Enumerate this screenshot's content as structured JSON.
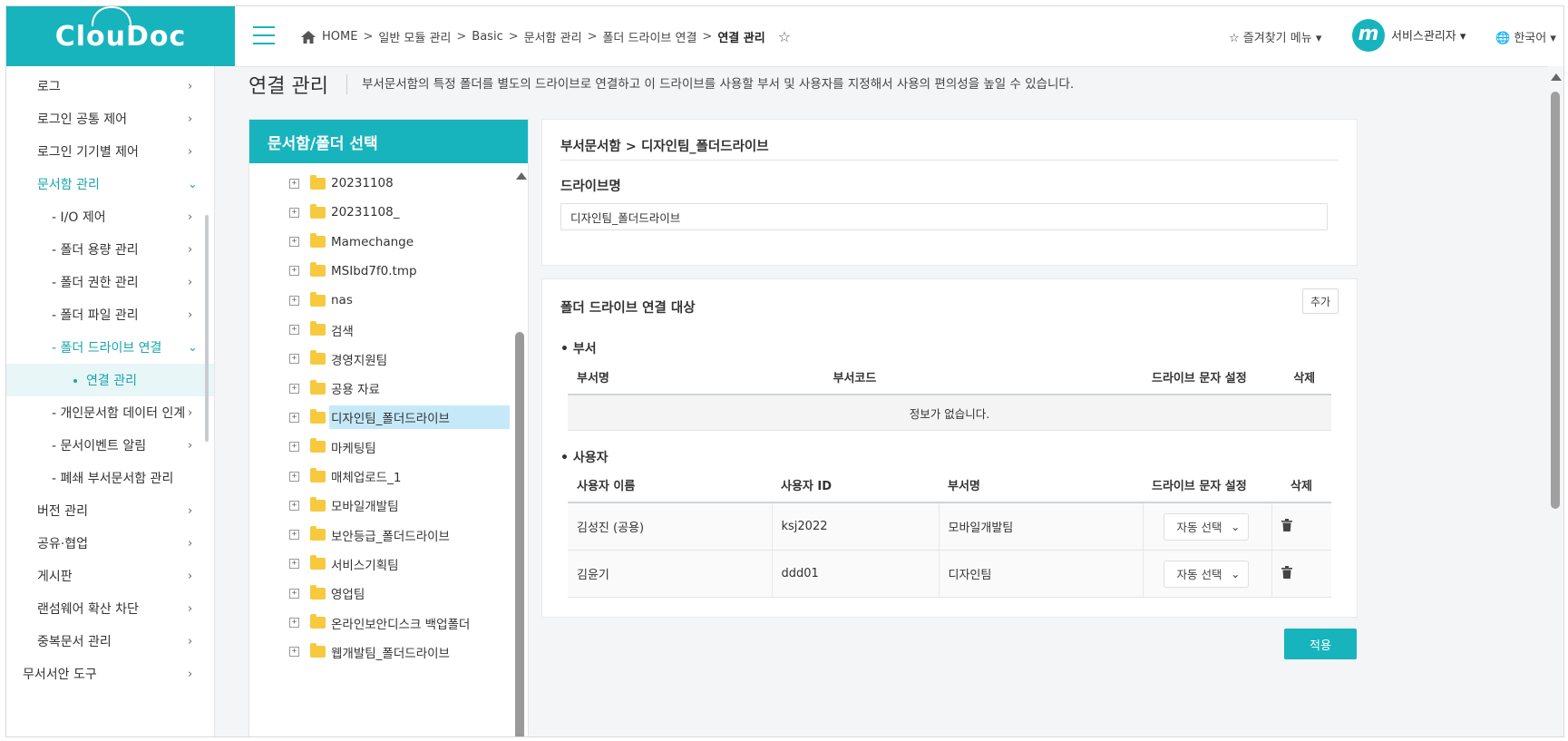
{
  "app": {
    "logo": "ClouDoc"
  },
  "topbar": {
    "breadcrumb": [
      "HOME",
      "일반 모듈 관리",
      "Basic",
      "문서함 관리",
      "폴더 드라이브 연결"
    ],
    "breadcrumb_current": "연결 관리",
    "favorites": "즐겨찾기 메뉴",
    "user_badge": "m",
    "user": "서비스관리자",
    "language": "한국어",
    "caret": "▾"
  },
  "sidebar": {
    "items": [
      {
        "label": "로그"
      },
      {
        "label": "로그인 공통 제어"
      },
      {
        "label": "로그인 기기별 제어"
      },
      {
        "label": "문서함 관리"
      },
      {
        "label": "- I/O 제어"
      },
      {
        "label": "- 폴더 용량 관리"
      },
      {
        "label": "- 폴더 권한 관리"
      },
      {
        "label": "- 폴더 파일 관리"
      },
      {
        "label": "- 폴더 드라이브 연결"
      },
      {
        "label": "연결 관리"
      },
      {
        "label": "- 개인문서함 데이터 인계"
      },
      {
        "label": "- 문서이벤트 알림"
      },
      {
        "label": "- 폐쇄 부서문서함 관리"
      },
      {
        "label": "버전 관리"
      },
      {
        "label": "공유·협업"
      },
      {
        "label": "게시판"
      },
      {
        "label": "랜섬웨어 확산 차단"
      },
      {
        "label": "중복문서 관리"
      },
      {
        "label": "무서서안 도구"
      }
    ],
    "chevron_right": "›",
    "chevron_down": "⌄"
  },
  "page": {
    "title": "연결 관리",
    "description": "부서문서함의 특정 폴더를 별도의 드라이브로 연결하고 이 드라이브를 사용할 부서 및 사용자를 지정해서 사용의 편의성을 높일 수 있습니다."
  },
  "tree": {
    "header": "문서함/폴더 선택",
    "expander": "+",
    "items": [
      {
        "name": "20231108"
      },
      {
        "name": "20231108_"
      },
      {
        "name": "Mamechange"
      },
      {
        "name": "MSIbd7f0.tmp"
      },
      {
        "name": "nas"
      },
      {
        "name": "검색"
      },
      {
        "name": "경영지원팀"
      },
      {
        "name": "공용 자료"
      },
      {
        "name": "디자인팀_폴더드라이브"
      },
      {
        "name": "마케팅팀"
      },
      {
        "name": "매체업로드_1"
      },
      {
        "name": "모바일개발팀"
      },
      {
        "name": "보안등급_폴더드라이브"
      },
      {
        "name": "서비스기획팀"
      },
      {
        "name": "영업팀"
      },
      {
        "name": "온라인보안디스크 백업폴더"
      },
      {
        "name": "웹개발팀_폴더드라이브"
      }
    ],
    "selected_index": 8
  },
  "drive": {
    "path": "부서문서함 > 디자인팀_폴더드라이브",
    "name_label": "드라이브명",
    "name_value": "디자인팀_폴더드라이브"
  },
  "targets": {
    "title": "폴더 드라이브 연결 대상",
    "add_label": "추가",
    "dept": {
      "title": "부서",
      "columns": [
        "부서명",
        "부서코드",
        "드라이브 문자 설정",
        "삭제"
      ],
      "empty": "정보가 없습니다."
    },
    "user": {
      "title": "사용자",
      "columns": [
        "사용자 이름",
        "사용자 ID",
        "부서명",
        "드라이브 문자 설정",
        "삭제"
      ],
      "rows": [
        {
          "name": "김성진 (공용)",
          "id": "ksj2022",
          "dept": "모바일개발팀",
          "drive": "자동 선택"
        },
        {
          "name": "김윤기",
          "id": "ddd01",
          "dept": "디자인팀",
          "drive": "자동 선택"
        }
      ]
    }
  },
  "apply_label": "적용",
  "colors": {
    "accent": "#17b4bd",
    "selected_tree": "#c5e9f9"
  }
}
